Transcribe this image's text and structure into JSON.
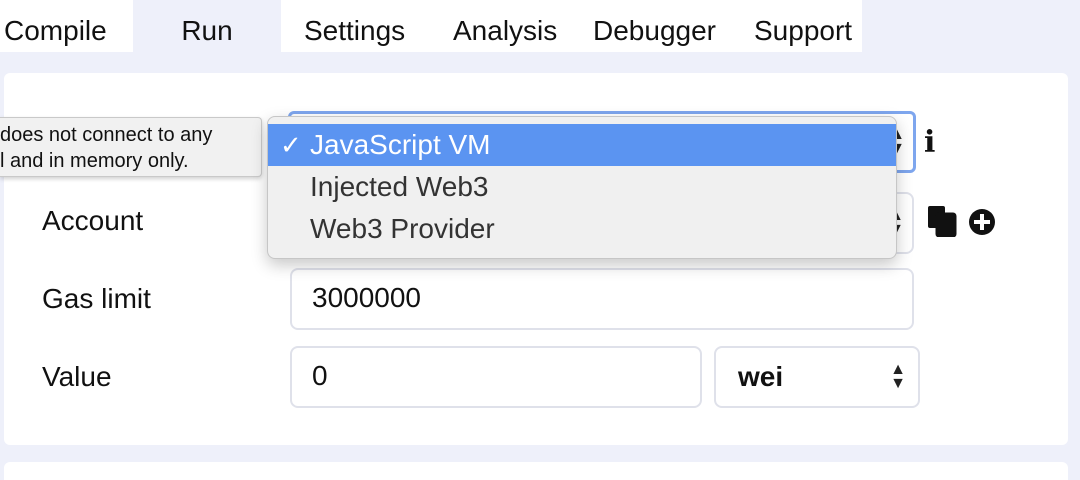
{
  "tabs": [
    {
      "label": "Compile",
      "active": false
    },
    {
      "label": "Run",
      "active": true
    },
    {
      "label": "Settings",
      "active": false
    },
    {
      "label": "Analysis",
      "active": false
    },
    {
      "label": "Debugger",
      "active": false
    },
    {
      "label": "Support",
      "active": false
    }
  ],
  "environment": {
    "tooltip_line1": "does not connect to any",
    "tooltip_line2": "l and in memory only.",
    "options": [
      {
        "label": "JavaScript VM",
        "selected": true
      },
      {
        "label": "Injected Web3",
        "selected": false
      },
      {
        "label": "Web3 Provider",
        "selected": false
      }
    ],
    "check_mark": "✓"
  },
  "account": {
    "label": "Account",
    "copy_icon": "copy-icon",
    "add_icon": "plus-circle-icon"
  },
  "gas_limit": {
    "label": "Gas limit",
    "value": "3000000"
  },
  "value": {
    "label": "Value",
    "amount": "0",
    "unit": "wei"
  },
  "colors": {
    "background": "#eef0fa",
    "selection": "#5b94f1",
    "focus_border": "#7ea6ee"
  }
}
